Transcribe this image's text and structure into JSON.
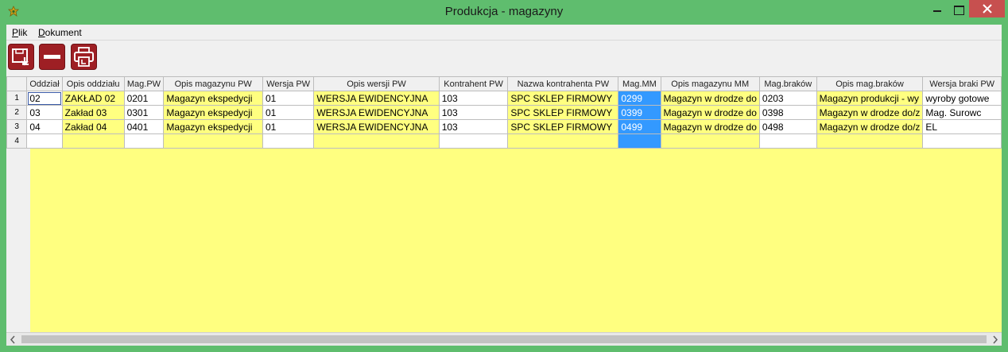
{
  "window": {
    "title": "Produkcja - magazyny",
    "colors": {
      "frame": "#5fbd6e",
      "close": "#c7504f"
    }
  },
  "menu": {
    "items": [
      {
        "label": "Plik",
        "mnemonic": "P",
        "rest": "lik"
      },
      {
        "label": "Dokument",
        "mnemonic": "D",
        "rest": "okument"
      }
    ]
  },
  "toolbar": {
    "buttons": [
      {
        "name": "save-icon"
      },
      {
        "name": "minus-icon"
      },
      {
        "name": "print-icon"
      }
    ]
  },
  "table": {
    "columns": [
      "Oddział",
      "Opis oddziału",
      "Mag.PW",
      "Opis magazynu PW",
      "Wersja PW",
      "Opis wersji PW",
      "Kontrahent PW",
      "Nazwa kontrahenta PW",
      "Mag.MM",
      "Opis magazynu MM",
      "Mag.braków",
      "Opis mag.braków",
      "Wersja braki PW"
    ],
    "rows": [
      {
        "num": "1",
        "cells": [
          "02",
          "ZAKŁAD 02",
          "0201",
          "Magazyn ekspedycji",
          "01",
          "WERSJA EWIDENCYJNA",
          "103",
          "SPC SKLEP FIRMOWY",
          "0299",
          "Magazyn w drodze do",
          "0203",
          "Magazyn produkcji - wy",
          "wyroby gotowe"
        ]
      },
      {
        "num": "2",
        "cells": [
          "03",
          "Zakład 03",
          "0301",
          "Magazyn ekspedycji",
          "01",
          "WERSJA EWIDENCYJNA",
          "103",
          "SPC SKLEP FIRMOWY",
          "0399",
          "Magazyn w drodze do",
          "0398",
          "Magazyn w drodze do/z",
          "Mag. Surowc"
        ]
      },
      {
        "num": "3",
        "cells": [
          "04",
          "Zakład 04",
          "0401",
          "Magazyn ekspedycji",
          "01",
          "WERSJA EWIDENCYJNA",
          "103",
          "SPC SKLEP FIRMOWY",
          "0499",
          "Magazyn w drodze do",
          "0498",
          "Magazyn w drodze do/z",
          "EL"
        ]
      },
      {
        "num": "4",
        "cells": [
          "",
          "",
          "",
          "",
          "",
          "",
          "",
          "",
          "",
          "",
          "",
          "",
          ""
        ]
      }
    ],
    "column_colors": [
      "w",
      "y",
      "w",
      "y",
      "w",
      "y",
      "w",
      "y",
      "b",
      "y",
      "w",
      "y",
      "w"
    ],
    "colors": {
      "background": "#ffff80",
      "selected": "#3399ff",
      "header": "#f0f0f0"
    }
  }
}
